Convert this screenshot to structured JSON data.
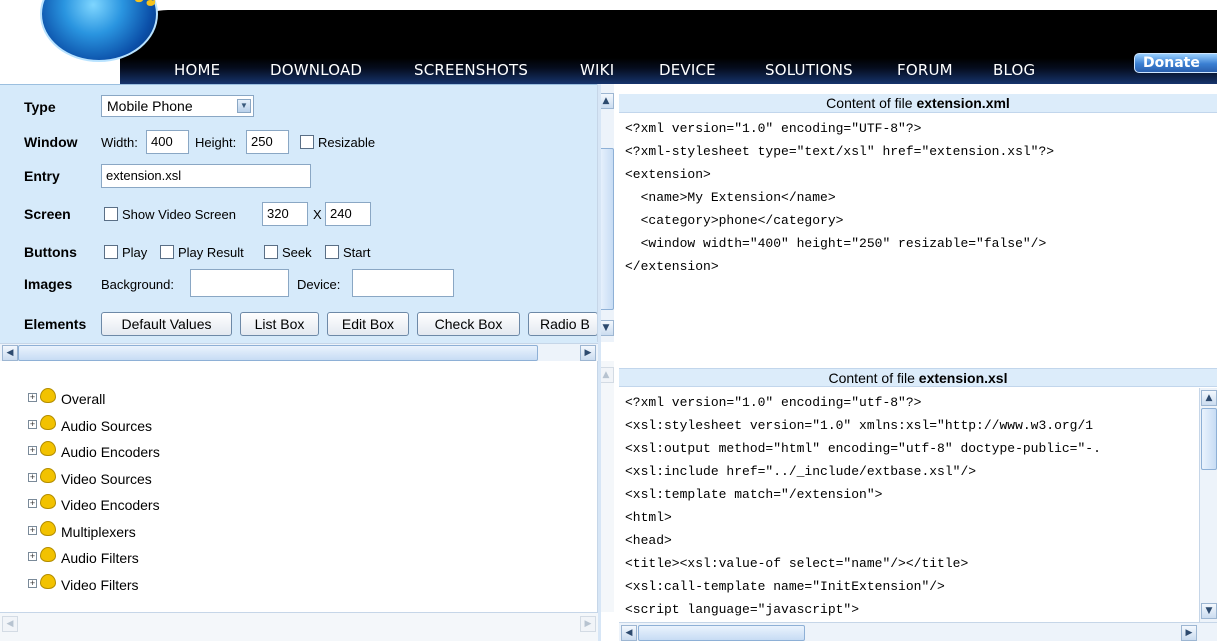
{
  "nav": {
    "items": [
      "HOME",
      "DOWNLOAD",
      "SCREENSHOTS",
      "WIKI",
      "DEVICE",
      "SOLUTIONS",
      "FORUM",
      "BLOG"
    ],
    "donate_label": "Donate"
  },
  "form": {
    "type": {
      "label": "Type",
      "value": "Mobile Phone"
    },
    "window": {
      "label": "Window",
      "width_label": "Width:",
      "width_value": "400",
      "height_label": "Height:",
      "height_value": "250",
      "resizable_label": "Resizable"
    },
    "entry": {
      "label": "Entry",
      "value": "extension.xsl"
    },
    "screen": {
      "label": "Screen",
      "show_video_label": "Show Video Screen",
      "width_value": "320",
      "x_label": "X",
      "height_value": "240"
    },
    "buttons": {
      "label": "Buttons",
      "options": [
        "Play",
        "Play Result",
        "Seek",
        "Start"
      ]
    },
    "images": {
      "label": "Images",
      "background_label": "Background:",
      "background_value": "",
      "device_label": "Device:",
      "device_value": ""
    },
    "elements": {
      "label": "Elements",
      "buttons": [
        "Default Values",
        "List Box",
        "Edit Box",
        "Check Box",
        "Radio B"
      ]
    }
  },
  "tree": {
    "items": [
      "Overall",
      "Audio Sources",
      "Audio Encoders",
      "Video Sources",
      "Video Encoders",
      "Multiplexers",
      "Audio Filters",
      "Video Filters"
    ]
  },
  "xml_panel": {
    "caption_prefix": "Content of file ",
    "filename": "extension.xml",
    "lines": [
      "<?xml version=\"1.0\" encoding=\"UTF-8\"?>",
      "<?xml-stylesheet type=\"text/xsl\" href=\"extension.xsl\"?>",
      "<extension>",
      "  <name>My Extension</name>",
      "  <category>phone</category>",
      "  <window width=\"400\" height=\"250\" resizable=\"false\"/>",
      "</extension>"
    ]
  },
  "xsl_panel": {
    "caption_prefix": "Content of file ",
    "filename": "extension.xsl",
    "lines": [
      "<?xml version=\"1.0\" encoding=\"utf-8\"?>",
      "<xsl:stylesheet version=\"1.0\" xmlns:xsl=\"http://www.w3.org/1",
      "<xsl:output method=\"html\" encoding=\"utf-8\" doctype-public=\"-.",
      "<xsl:include href=\"../_include/extbase.xsl\"/>",
      "<xsl:template match=\"/extension\">",
      "<html>",
      "<head>",
      "<title><xsl:value-of select=\"name\"/></title>",
      "<xsl:call-template name=\"InitExtension\"/>",
      "<script language=\"javascript\">"
    ]
  },
  "icons": {
    "tree_expand": "plus-box-icon",
    "tree_folder": "folder-icon",
    "scroll_up": "arrow-up-icon",
    "scroll_down": "arrow-down-icon",
    "scroll_left": "arrow-left-icon",
    "scroll_right": "arrow-right-icon",
    "select_arrow": "chevron-down-icon"
  },
  "colors": {
    "nav_background": "#000000",
    "form_background": "#d6eafa",
    "caption_background": "#dcecfa",
    "folder": "#f2c200"
  }
}
